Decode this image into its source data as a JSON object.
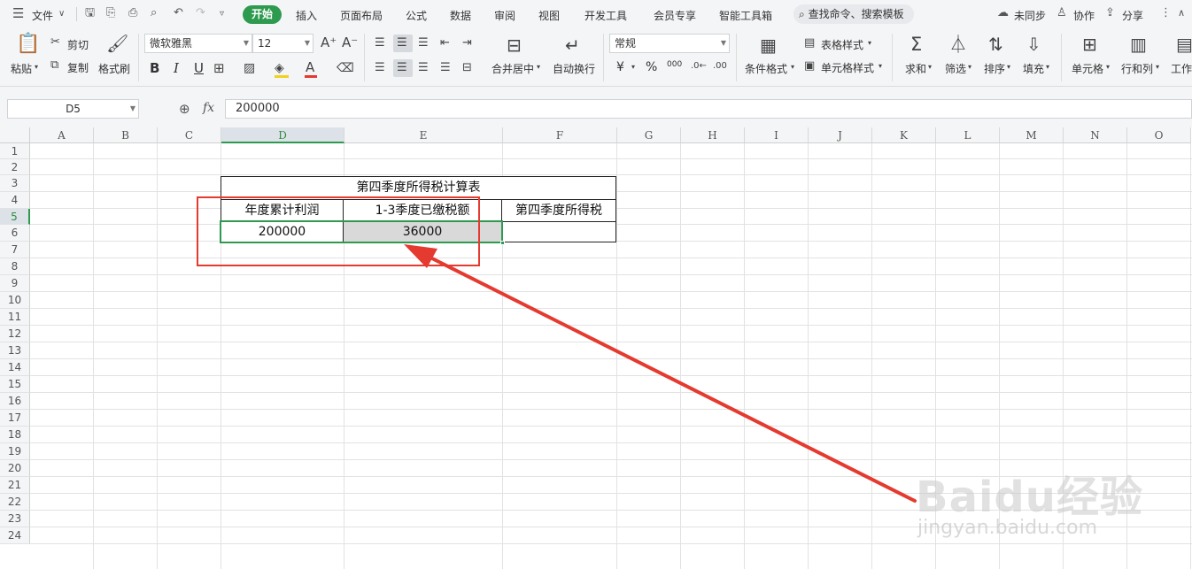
{
  "menubar": {
    "file_label": "文件",
    "tabs": [
      {
        "label": "开始",
        "active": true
      },
      {
        "label": "插入"
      },
      {
        "label": "页面布局"
      },
      {
        "label": "公式"
      },
      {
        "label": "数据"
      },
      {
        "label": "审阅"
      },
      {
        "label": "视图"
      },
      {
        "label": "开发工具"
      },
      {
        "label": "会员专享"
      },
      {
        "label": "智能工具箱"
      }
    ],
    "search_placeholder": "查找命令、搜索模板",
    "sync_label": "未同步",
    "collab_label": "协作",
    "share_label": "分享"
  },
  "ribbon": {
    "paste": "粘贴",
    "cut": "剪切",
    "copy": "复制",
    "format_painter": "格式刷",
    "font_name": "微软雅黑",
    "font_size": "12",
    "bold": "B",
    "italic": "I",
    "underline": "U",
    "merge_center": "合并居中",
    "wrap_text": "自动换行",
    "number_format": "常规",
    "currency": "¥",
    "percent": "%",
    "thousands": "000",
    "conditional_format": "条件格式",
    "table_style": "表格样式",
    "cell_style": "单元格样式",
    "sum": "求和",
    "filter": "筛选",
    "sort": "排序",
    "fill": "填充",
    "cell": "单元格",
    "row_col": "行和列",
    "worksheet": "工作"
  },
  "formula_bar": {
    "name_box": "D5",
    "fx_label": "fx",
    "formula": "200000"
  },
  "grid": {
    "columns": [
      "A",
      "B",
      "C",
      "D",
      "E",
      "F",
      "G",
      "H",
      "I",
      "J",
      "K",
      "L",
      "M",
      "N",
      "O"
    ],
    "rows": [
      "1",
      "2",
      "3",
      "4",
      "5",
      "6",
      "7",
      "8",
      "9",
      "10",
      "11",
      "12",
      "13",
      "14",
      "15",
      "16",
      "17",
      "18",
      "19",
      "20",
      "21",
      "22",
      "23",
      "24"
    ],
    "selected_column": "D",
    "selected_row": "5"
  },
  "table": {
    "title": "第四季度所得税计算表",
    "headers": [
      "年度累计利润",
      "1-3季度已缴税额",
      "第四季度所得税"
    ],
    "row": [
      "200000",
      "36000",
      ""
    ]
  },
  "colors": {
    "accent_green": "#2e9a4f",
    "annotation_red": "#e53a2f"
  },
  "watermark": {
    "text": "Baidu经验",
    "sub": "jingyan.baidu.com"
  }
}
